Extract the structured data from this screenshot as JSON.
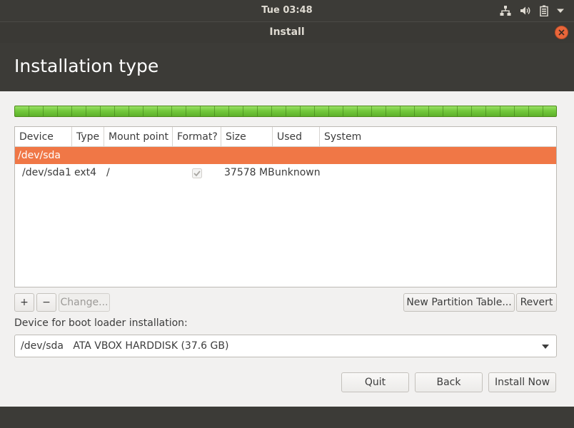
{
  "top_panel": {
    "clock": "Tue 03:48",
    "icons": [
      "network-icon",
      "volume-icon",
      "battery-icon",
      "chevron-down-icon"
    ]
  },
  "window": {
    "title": "Install",
    "close_icon": "close-icon"
  },
  "page": {
    "title": "Installation type"
  },
  "colors": {
    "accent": "#f07746",
    "close": "#e9663a",
    "partition_bar": "#6fc33a",
    "panel": "#3c3b37"
  },
  "table": {
    "columns": [
      "Device",
      "Type",
      "Mount point",
      "Format?",
      "Size",
      "Used",
      "System"
    ],
    "rows": [
      {
        "device": "/dev/sda",
        "selected": true
      },
      {
        "device": "/dev/sda1",
        "type": "ext4",
        "mount": "/",
        "format": true,
        "size": "37578 MB",
        "used": "unknown",
        "system": ""
      }
    ]
  },
  "toolbar": {
    "add_label": "+",
    "remove_label": "−",
    "change_label": "Change...",
    "new_table_label": "New Partition Table...",
    "revert_label": "Revert"
  },
  "boot_loader": {
    "label": "Device for boot loader installation:",
    "selected": "/dev/sda   ATA VBOX HARDDISK (37.6 GB)"
  },
  "nav": {
    "quit_label": "Quit",
    "back_label": "Back",
    "install_label": "Install Now"
  }
}
